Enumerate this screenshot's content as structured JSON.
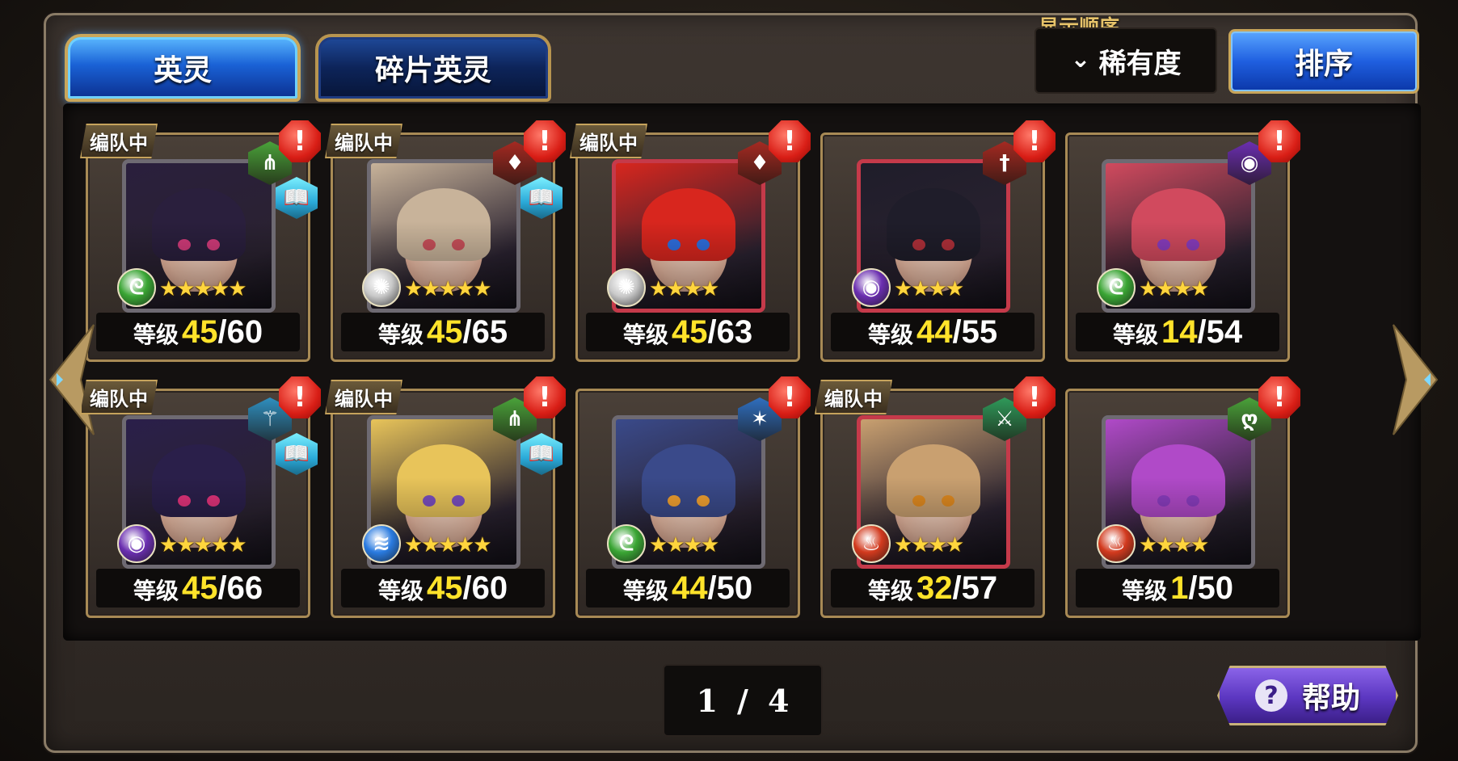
{
  "tabs": [
    {
      "label": "英灵",
      "active": true
    },
    {
      "label": "碎片英灵",
      "active": false
    }
  ],
  "sort": {
    "caption": "显示顺序",
    "selected": "稀有度",
    "button_label": "排序"
  },
  "level_label": "等级",
  "team_badge_label": "编队中",
  "alert_glyph": "!",
  "cards": [
    {
      "in_team": true,
      "cur": "45",
      "max": "/60",
      "stars": 5,
      "frame": "#6e6a72",
      "hair": "#2a1f3d",
      "eye": "#d23b7a",
      "class_color": "#4aa23a",
      "class_glyph": "⋔",
      "book": true,
      "elem_color": "#3aa534",
      "elem_glyph": "ᘓ"
    },
    {
      "in_team": true,
      "cur": "45",
      "max": "/65",
      "stars": 5,
      "frame": "#6e6a72",
      "hair": "#c8b39a",
      "eye": "#c9505a",
      "class_color": "#a52a22",
      "class_glyph": "♦",
      "book": true,
      "elem_color": "#c9c9c9",
      "elem_glyph": "✺"
    },
    {
      "in_team": true,
      "cur": "45",
      "max": "/63",
      "stars": 4,
      "frame": "#c53a4a",
      "hair": "#d8261e",
      "eye": "#2f6fe0",
      "class_color": "#a52a22",
      "class_glyph": "♦",
      "book": false,
      "elem_color": "#c9c9c9",
      "elem_glyph": "✺"
    },
    {
      "in_team": false,
      "cur": "44",
      "max": "/55",
      "stars": 4,
      "frame": "#c53a4a",
      "hair": "#1f1d2a",
      "eye": "#b0303a",
      "class_color": "#a52a22",
      "class_glyph": "†",
      "book": false,
      "elem_color": "#6b2fb0",
      "elem_glyph": "◉"
    },
    {
      "in_team": false,
      "cur": "14",
      "max": "/54",
      "stars": 4,
      "frame": "#6e6a72",
      "hair": "#d14a5e",
      "eye": "#8a3dbf",
      "class_color": "#6b2fb0",
      "class_glyph": "◉",
      "book": false,
      "elem_color": "#3aa534",
      "elem_glyph": "ᘓ"
    },
    {
      "in_team": true,
      "cur": "45",
      "max": "/66",
      "stars": 5,
      "frame": "#6e6a72",
      "hair": "#2a1f4a",
      "eye": "#e0337a",
      "class_color": "#2f8fbf",
      "class_glyph": "⚚",
      "book": true,
      "elem_color": "#6b2fb0",
      "elem_glyph": "◉"
    },
    {
      "in_team": true,
      "cur": "45",
      "max": "/60",
      "stars": 5,
      "frame": "#6e6a72",
      "hair": "#e8c45a",
      "eye": "#7a4fbf",
      "class_color": "#4aa23a",
      "class_glyph": "⋔",
      "book": true,
      "elem_color": "#2a7be0",
      "elem_glyph": "≋"
    },
    {
      "in_team": false,
      "cur": "44",
      "max": "/50",
      "stars": 4,
      "frame": "#6e6a72",
      "hair": "#3a4a8a",
      "eye": "#f0a030",
      "class_color": "#2f6fbf",
      "class_glyph": "✶",
      "book": false,
      "elem_color": "#3aa534",
      "elem_glyph": "ᘓ"
    },
    {
      "in_team": true,
      "cur": "32",
      "max": "/57",
      "stars": 4,
      "frame": "#c53a4a",
      "hair": "#c9a070",
      "eye": "#e08a20",
      "class_color": "#2f9a5a",
      "class_glyph": "⚔",
      "book": false,
      "elem_color": "#d23a1e",
      "elem_glyph": "♨"
    },
    {
      "in_team": false,
      "cur": "1",
      "max": "/50",
      "stars": 4,
      "frame": "#6e6a72",
      "hair": "#b04ac8",
      "eye": "#8a3dbf",
      "class_color": "#4aa23a",
      "class_glyph": "ღ",
      "book": false,
      "elem_color": "#d23a1e",
      "elem_glyph": "♨"
    }
  ],
  "pager": {
    "current": "1",
    "separator": "/",
    "total": "4"
  },
  "help": {
    "label": "帮助",
    "icon": "question-icon",
    "glyph": "?"
  },
  "nav": {
    "prev_icon": "arrow-left-icon",
    "next_icon": "arrow-right-icon"
  }
}
